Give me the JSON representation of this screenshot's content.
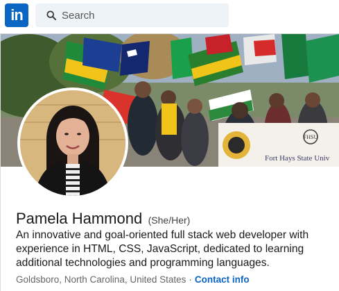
{
  "header": {
    "logo_text": "in",
    "search_placeholder": "Search"
  },
  "profile": {
    "name": "Pamela Hammond",
    "pronouns": "(She/Her)",
    "headline": "An innovative and goal-oriented full stack web developer with experience in HTML, CSS, JavaScript, dedicated to learning additional technologies and programming languages.",
    "location": "Goldsboro, North Carolina, United States",
    "separator": "·",
    "contact_label": "Contact info"
  },
  "banner": {
    "sign_text": "Fort Hays State Univ",
    "sign_abbrev": "FHSU"
  },
  "colors": {
    "brand": "#0a66c2",
    "search_bg": "#eef3f8"
  }
}
